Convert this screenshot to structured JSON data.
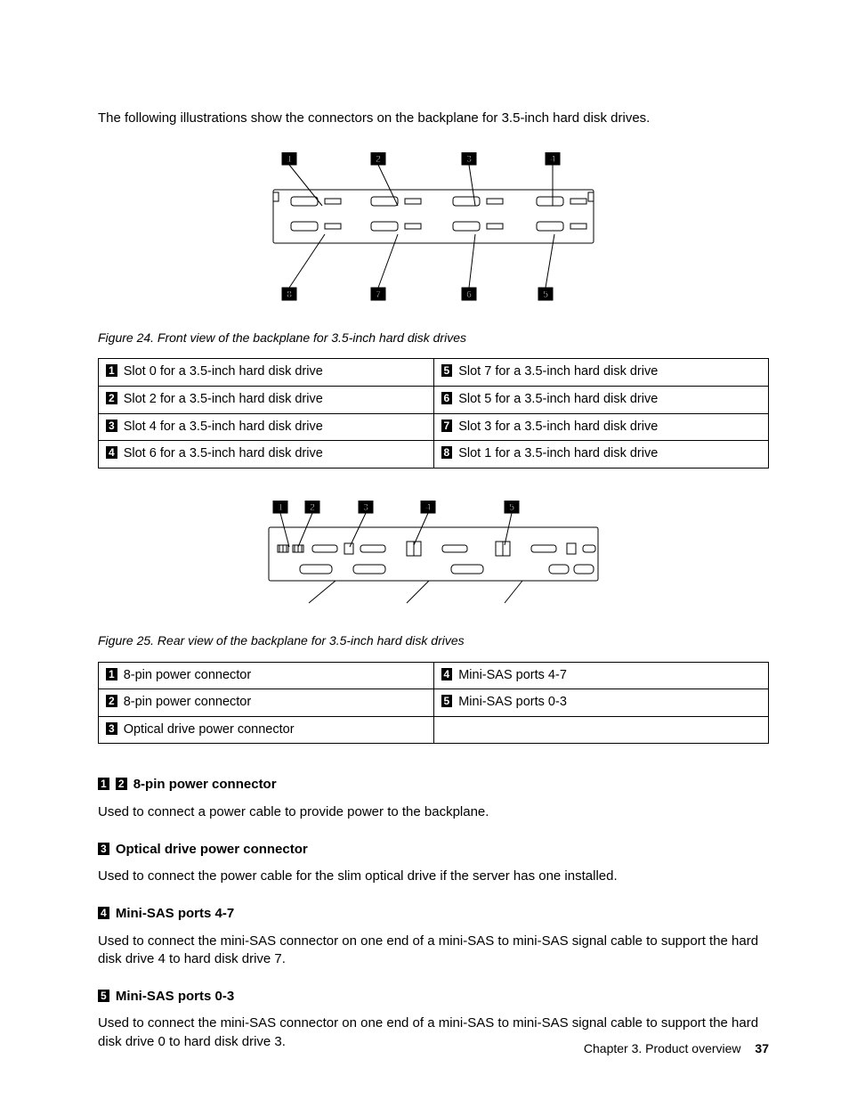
{
  "intro": "The following illustrations show the connectors on the backplane for 3.5-inch hard disk drives.",
  "fig24": {
    "caption": "Figure 24.  Front view of the backplane for 3.5-inch hard disk drives",
    "labels": {
      "top": [
        "1",
        "2",
        "3",
        "4"
      ],
      "bottom": [
        "8",
        "7",
        "6",
        "5"
      ]
    }
  },
  "table24": {
    "rows": [
      {
        "ln": "1",
        "lt": "Slot 0 for a 3.5-inch hard disk drive",
        "rn": "5",
        "rt": "Slot 7 for a 3.5-inch hard disk drive"
      },
      {
        "ln": "2",
        "lt": "Slot 2 for a 3.5-inch hard disk drive",
        "rn": "6",
        "rt": "Slot 5 for a 3.5-inch hard disk drive"
      },
      {
        "ln": "3",
        "lt": "Slot 4 for a 3.5-inch hard disk drive",
        "rn": "7",
        "rt": "Slot 3 for a 3.5-inch hard disk drive"
      },
      {
        "ln": "4",
        "lt": "Slot 6 for a 3.5-inch hard disk drive",
        "rn": "8",
        "rt": "Slot 1 for a 3.5-inch hard disk drive"
      }
    ]
  },
  "fig25": {
    "caption": "Figure 25.  Rear view of the backplane for 3.5-inch hard disk drives",
    "labels": [
      "1",
      "2",
      "3",
      "4",
      "5"
    ]
  },
  "table25": {
    "rows": [
      {
        "ln": "1",
        "lt": "8-pin power connector",
        "rn": "4",
        "rt": "Mini-SAS ports 4-7"
      },
      {
        "ln": "2",
        "lt": "8-pin power connector",
        "rn": "5",
        "rt": "Mini-SAS ports 0-3"
      },
      {
        "ln": "3",
        "lt": "Optical drive power connector",
        "rn": "",
        "rt": ""
      }
    ]
  },
  "sections": [
    {
      "chips": [
        "1",
        "2"
      ],
      "title": "8-pin power connector",
      "body": "Used to connect a power cable to provide power to the backplane."
    },
    {
      "chips": [
        "3"
      ],
      "title": "Optical drive power connector",
      "body": "Used to connect the power cable for the slim optical drive if the server has one installed."
    },
    {
      "chips": [
        "4"
      ],
      "title": "Mini-SAS ports 4-7",
      "body": "Used to connect the mini-SAS connector on one end of a mini-SAS to mini-SAS signal cable to support the hard disk drive 4 to hard disk drive 7."
    },
    {
      "chips": [
        "5"
      ],
      "title": "Mini-SAS ports 0-3",
      "body": "Used to connect the mini-SAS connector on one end of a mini-SAS to mini-SAS signal cable to support the hard disk drive 0 to hard disk drive 3."
    }
  ],
  "footer": {
    "chapter": "Chapter 3.  Product overview",
    "page": "37"
  }
}
